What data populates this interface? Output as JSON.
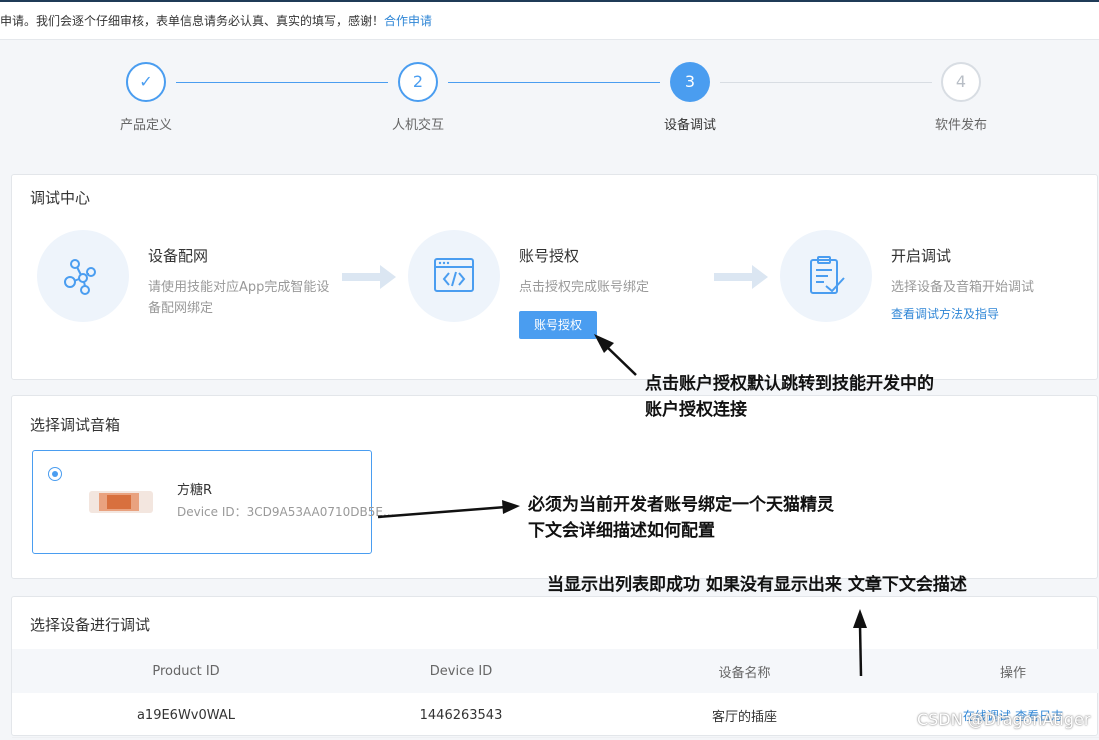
{
  "notice": {
    "text": "申请。我们会逐个仔细审核，表单信息请务必认真、真实的填写，感谢！",
    "link": "合作申请"
  },
  "steps": [
    {
      "number": "✓",
      "label": "产品定义",
      "state": "done"
    },
    {
      "number": "2",
      "label": "人机交互",
      "state": "todo"
    },
    {
      "number": "3",
      "label": "设备调试",
      "state": "active"
    },
    {
      "number": "4",
      "label": "软件发布",
      "state": "future"
    }
  ],
  "debug_center": {
    "title": "调试中心",
    "items": [
      {
        "icon": "network-nodes-icon",
        "title": "设备配网",
        "desc": "请使用技能对应App完成智能设备配网绑定"
      },
      {
        "icon": "code-window-icon",
        "title": "账号授权",
        "desc": "点击授权完成账号绑定",
        "button": "账号授权"
      },
      {
        "icon": "clipboard-check-icon",
        "title": "开启调试",
        "desc": "选择设备及音箱开始调试",
        "link": "查看调试方法及指导"
      }
    ]
  },
  "speaker_section": {
    "title": "选择调试音箱",
    "speaker": {
      "name": "方糖R",
      "device_id": "Device ID：3CD9A53AA0710DB5E..."
    }
  },
  "device_section": {
    "title": "选择设备进行调试",
    "columns": [
      "Product ID",
      "Device ID",
      "设备名称",
      "操作"
    ],
    "rows": [
      {
        "product_id": "a19E6Wv0WAL",
        "device_id": "1446263543",
        "name": "客厅的插座",
        "ops": [
          "在线调试",
          "查看日志"
        ]
      }
    ]
  },
  "annotations": {
    "auth_note_line1": "点击账户授权默认跳转到技能开发中的",
    "auth_note_line2": "账户授权连接",
    "speaker_note_line1": "必须为当前开发者账号绑定一个天猫精灵",
    "speaker_note_line2": "下文会详细描述如何配置",
    "list_note": "当显示出列表即成功 如果没有显示出来 文章下文会描述"
  },
  "watermark": "CSDN @DragonAtiger",
  "colors": {
    "accent": "#4a9df0",
    "link": "#2f86d6",
    "icon_bg": "#eef4fb"
  }
}
